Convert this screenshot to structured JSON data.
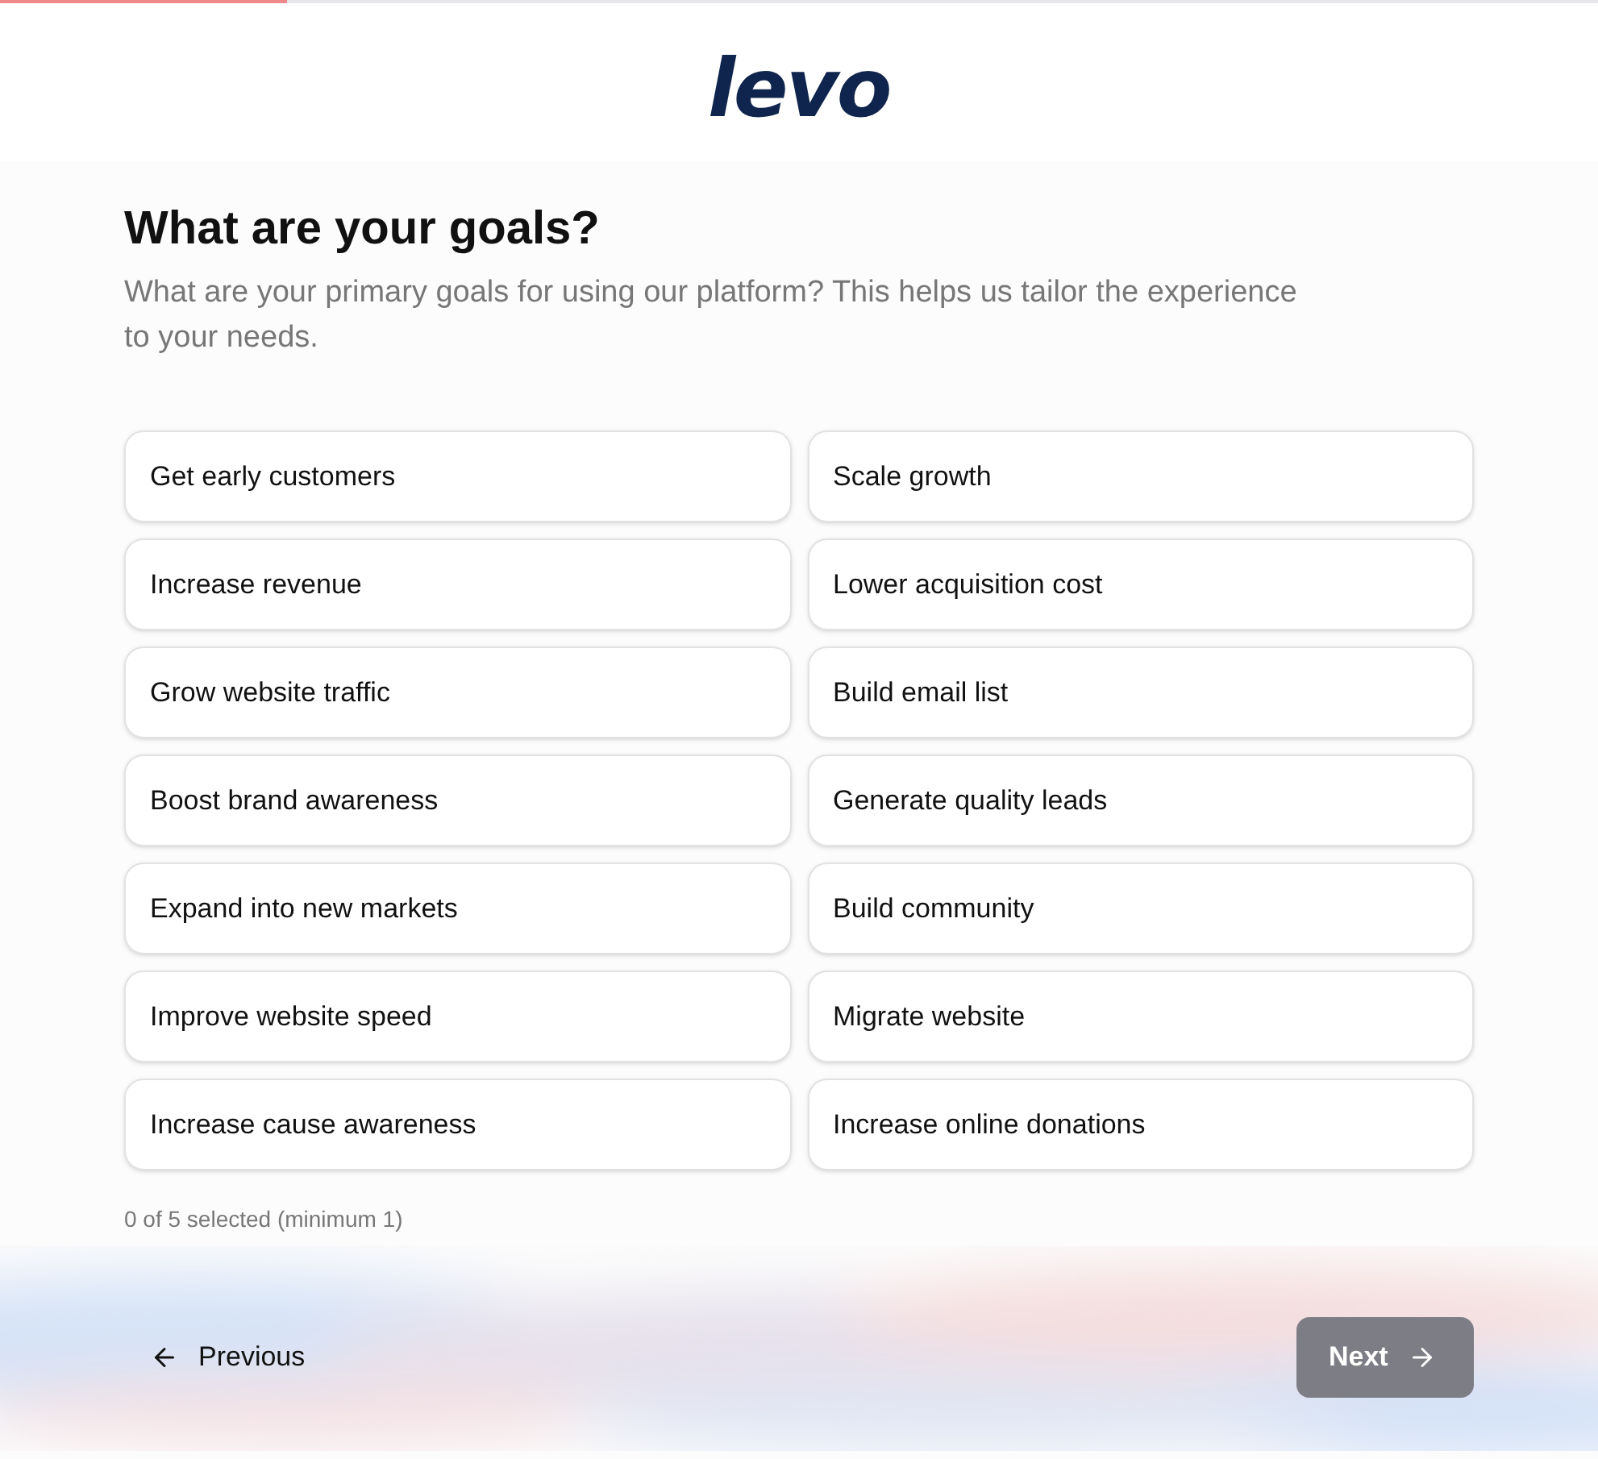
{
  "progress": {
    "level": 0.18
  },
  "logo": "levo",
  "title": "What are your goals?",
  "subtitle": "What are your primary goals for using our platform? This helps us tailor the experience to your needs.",
  "options": [
    {
      "label": "Get early customers",
      "selected": false
    },
    {
      "label": "Scale growth",
      "selected": false
    },
    {
      "label": "Increase revenue",
      "selected": false
    },
    {
      "label": "Lower acquisition cost",
      "selected": false
    },
    {
      "label": "Grow website traffic",
      "selected": false
    },
    {
      "label": "Build email list",
      "selected": false
    },
    {
      "label": "Boost brand awareness",
      "selected": false
    },
    {
      "label": "Generate quality leads",
      "selected": false
    },
    {
      "label": "Expand into new markets",
      "selected": false
    },
    {
      "label": "Build community",
      "selected": false
    },
    {
      "label": "Improve website speed",
      "selected": false
    },
    {
      "label": "Migrate website",
      "selected": false
    },
    {
      "label": "Increase cause awareness",
      "selected": false
    },
    {
      "label": "Increase online donations",
      "selected": false
    }
  ],
  "selection_count": "0 of 5 selected (minimum 1)",
  "previous_button": {
    "label": "Previous"
  },
  "next_button": {
    "label": "Next",
    "disabled": true
  }
}
